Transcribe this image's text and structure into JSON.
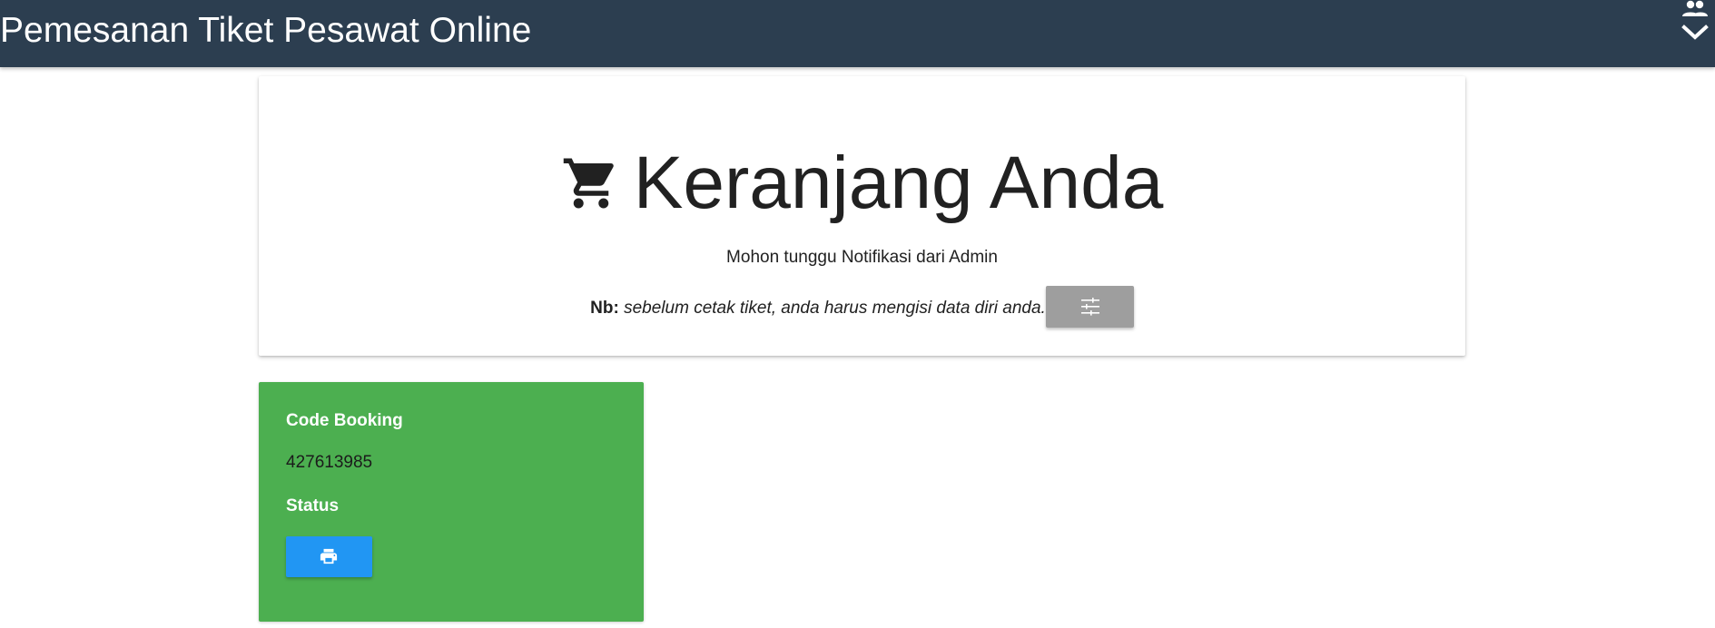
{
  "header": {
    "title": "Pemesanan Tiket Pesawat Online",
    "account_icon": "account-group-icon",
    "dropdown_icon": "chevron-down-icon",
    "bg_color": "#2c3e50"
  },
  "cart": {
    "icon": "shopping-cart-icon",
    "title": "Keranjang Anda",
    "notice": "Mohon tunggu Notifikasi dari Admin",
    "nb_label": "Nb:",
    "nb_text": "sebelum cetak tiket, anda harus mengisi data diri anda.",
    "settings_icon": "tune-sliders-icon",
    "settings_button_color": "#9e9e9e"
  },
  "booking": {
    "code_label": "Code Booking",
    "code_value": "427613985",
    "status_label": "Status",
    "print_icon": "print-icon",
    "card_color": "#4caf50",
    "print_button_color": "#2196f3"
  }
}
